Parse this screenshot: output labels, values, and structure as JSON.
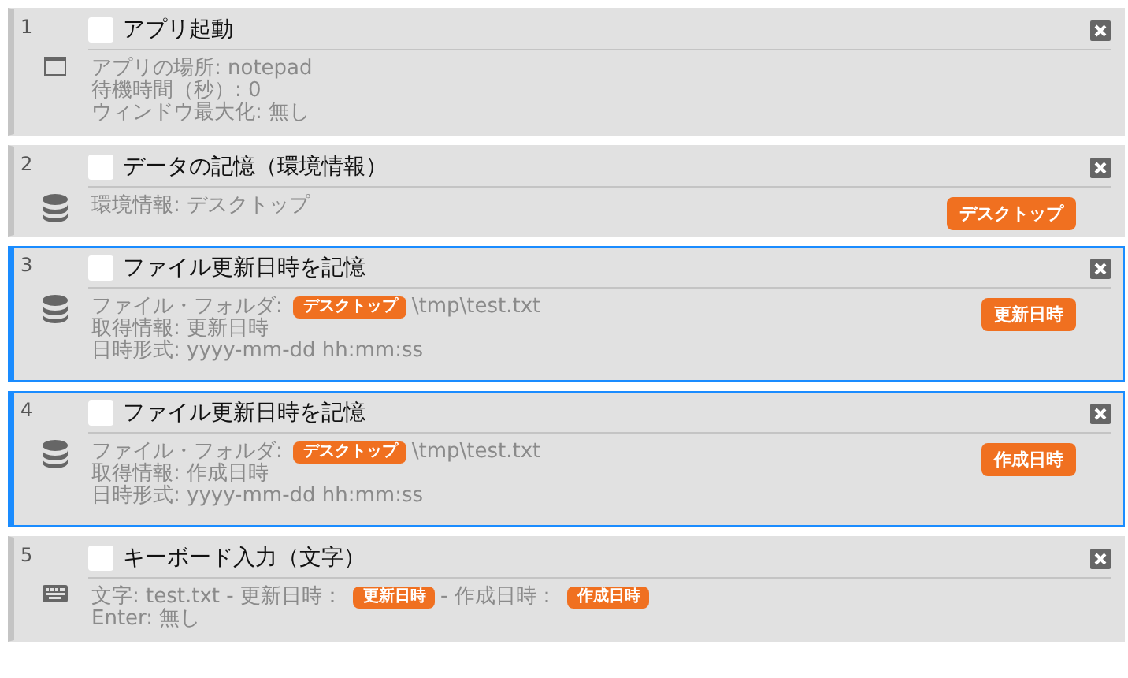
{
  "steps": [
    {
      "number": "1",
      "title": "アプリ起動",
      "checked": false,
      "selected": false,
      "kind": "launch",
      "lines": [
        [
          {
            "kind": "text",
            "text": "アプリの場所: notepad"
          }
        ],
        [
          {
            "kind": "text",
            "text": "待機時間（秒）: 0"
          }
        ],
        [
          {
            "kind": "text",
            "text": "ウィンドウ最大化: 無し"
          }
        ]
      ]
    },
    {
      "number": "2",
      "title": "データの記憶（環境情報）",
      "checked": false,
      "selected": false,
      "kind": "store",
      "lines": [
        [
          {
            "kind": "text",
            "text": "環境情報: デスクトップ"
          }
        ]
      ],
      "side_tag": "デスクトップ"
    },
    {
      "number": "3",
      "title": "ファイル更新日時を記憶",
      "checked": false,
      "selected": true,
      "kind": "store",
      "lines": [
        [
          {
            "kind": "text",
            "text": "ファイル・フォルダ:"
          },
          {
            "kind": "tag",
            "text": "デスクトップ"
          },
          {
            "kind": "text",
            "text": "\\tmp\\test.txt"
          }
        ],
        [
          {
            "kind": "text",
            "text": "取得情報: 更新日時"
          }
        ],
        [
          {
            "kind": "text",
            "text": "日時形式: yyyy-mm-dd hh:mm:ss"
          }
        ]
      ],
      "side_tag": "更新日時"
    },
    {
      "number": "4",
      "title": "ファイル更新日時を記憶",
      "checked": false,
      "selected": true,
      "kind": "store",
      "lines": [
        [
          {
            "kind": "text",
            "text": "ファイル・フォルダ:"
          },
          {
            "kind": "tag",
            "text": "デスクトップ"
          },
          {
            "kind": "text",
            "text": "\\tmp\\test.txt"
          }
        ],
        [
          {
            "kind": "text",
            "text": "取得情報: 作成日時"
          }
        ],
        [
          {
            "kind": "text",
            "text": "日時形式: yyyy-mm-dd hh:mm:ss"
          }
        ]
      ],
      "side_tag": "作成日時"
    },
    {
      "number": "5",
      "title": "キーボード入力（文字）",
      "checked": false,
      "selected": false,
      "kind": "type",
      "lines": [
        [
          {
            "kind": "text",
            "text": "文字: test.txt - 更新日時："
          },
          {
            "kind": "tag",
            "text": "更新日時"
          },
          {
            "kind": "text",
            "text": "- 作成日時："
          },
          {
            "kind": "tag",
            "text": "作成日時"
          }
        ],
        [
          {
            "kind": "text",
            "text": "Enter: 無し"
          }
        ]
      ]
    }
  ]
}
